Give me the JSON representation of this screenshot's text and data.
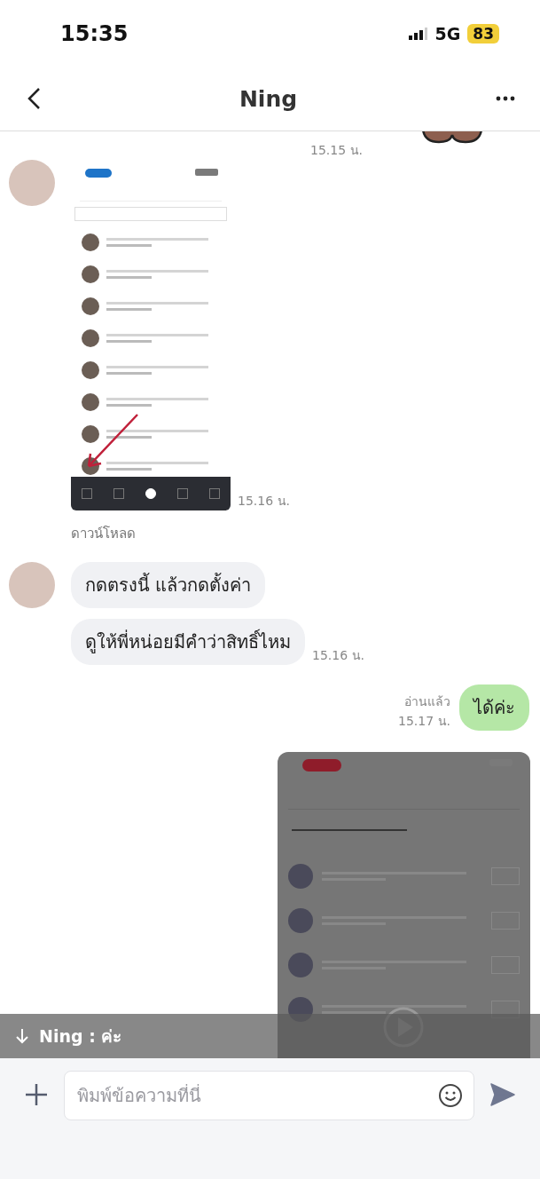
{
  "status_bar": {
    "time": "15:35",
    "network": "5G",
    "battery": "83"
  },
  "header": {
    "title": "Ning"
  },
  "messages": [
    {
      "kind": "sent-sticker",
      "time": "15.15 น."
    },
    {
      "kind": "received-image",
      "time": "15.16 น.",
      "link": "ดาวน์โหลด"
    },
    {
      "kind": "received-text",
      "bubbles": [
        "กดตรงนี้ แล้วกดตั้งค่า",
        "ดูให้พี่หน่อยมีคำว่าสิทธิ์ไหม"
      ],
      "time": "15.16 น."
    },
    {
      "kind": "sent-text",
      "text": "ได้ค่ะ",
      "read": "อ่านแล้ว",
      "time": "15.17 น."
    },
    {
      "kind": "sent-video"
    }
  ],
  "toast": {
    "text": "Ning : ค่ะ"
  },
  "composer": {
    "placeholder": "พิมพ์ข้อความที่นี่"
  }
}
